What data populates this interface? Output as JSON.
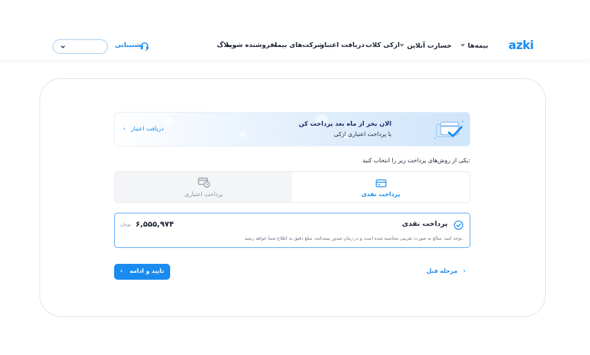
{
  "header": {
    "logo": "azki",
    "nav": [
      {
        "label": "بیمه‌ها",
        "dropdown": true
      },
      {
        "label": "خسارت آنلاین",
        "dropdown": true
      },
      {
        "label": "ازکی کلاب",
        "dropdown": false
      },
      {
        "label": "دریافت اعتبار",
        "dropdown": false
      },
      {
        "label": "شرکت‌های بیمه",
        "dropdown": false
      },
      {
        "label": "فروشنده شوید!",
        "dropdown": false
      },
      {
        "label": "بلاگ",
        "dropdown": false
      }
    ],
    "support_label": "پشتیبانی",
    "support_icon": "headset-icon",
    "select_value": ""
  },
  "banner": {
    "title": "الان بخر از ماه بعد پرداخت کن",
    "subtitle": "با پرداخت اعتباری ازکی",
    "link": "دریافت اعتبار"
  },
  "payment": {
    "prompt": "یکی از روش‌های پرداخت زیر را انتخاب کنید:",
    "tabs": [
      {
        "label": "پرداخت نقدی",
        "icon": "card-icon",
        "active": true
      },
      {
        "label": "پرداخت اعتباری",
        "icon": "credit-clock-icon",
        "active": false
      }
    ],
    "option": {
      "title": "پرداخت نقدی",
      "price": "۶,۵۵۵,۹۷۴",
      "currency": "تومان",
      "note": "توجه کنید: مبالغ به صورت تقریبی محاسبه شده است و در زمان صدور بیمه‌نامه، مبلغ دقیق به اطلاع شما خواهد رسید."
    }
  },
  "actions": {
    "confirm": "تایید و ادامه",
    "previous": "مرحله قبل"
  },
  "colors": {
    "accent": "#1a8cf0",
    "text": "#1d2433",
    "muted": "#8a93a1"
  }
}
